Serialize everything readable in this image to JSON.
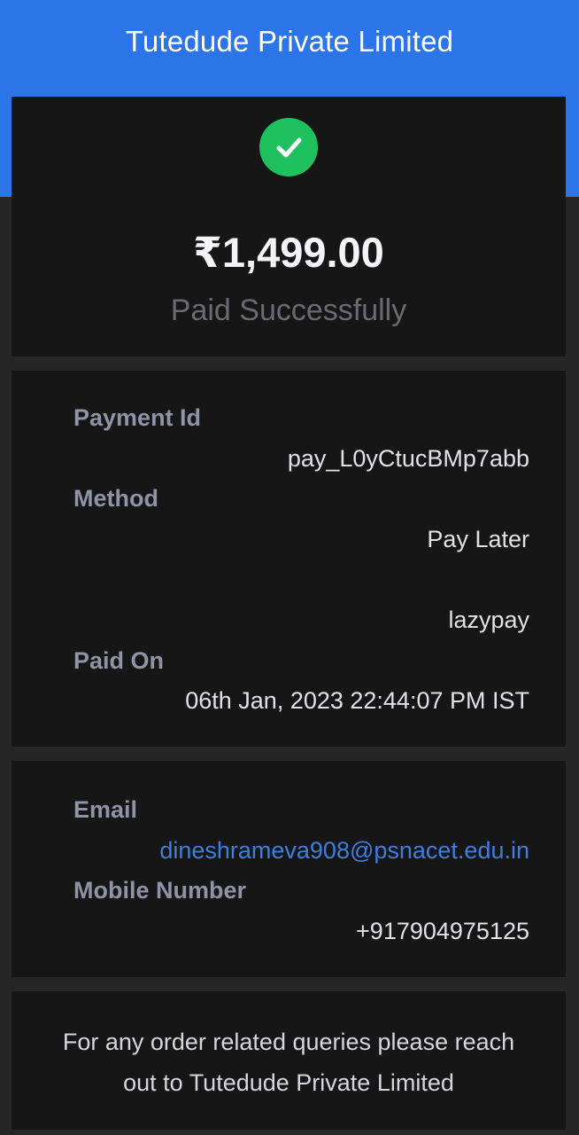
{
  "header": {
    "title": "Tutedude Private Limited"
  },
  "colors": {
    "header_bg": "#2b75e8",
    "success": "#1fc15f",
    "link": "#3c7fe0"
  },
  "payment": {
    "status_icon": "check-circle-icon",
    "amount": "₹1,499.00",
    "status": "Paid Successfully"
  },
  "details": {
    "payment_id_label": "Payment Id",
    "payment_id": "pay_L0yCtucBMp7abb",
    "method_label": "Method",
    "method": "Pay Later",
    "method_provider": "lazypay",
    "paid_on_label": "Paid On",
    "paid_on": "06th Jan, 2023 22:44:07 PM IST"
  },
  "contact": {
    "email_label": "Email",
    "email": "dineshrameva908@psnacet.edu.in",
    "mobile_label": "Mobile Number",
    "mobile": "+917904975125"
  },
  "note": {
    "text": "For any order related queries please reach out to Tutedude Private Limited"
  }
}
